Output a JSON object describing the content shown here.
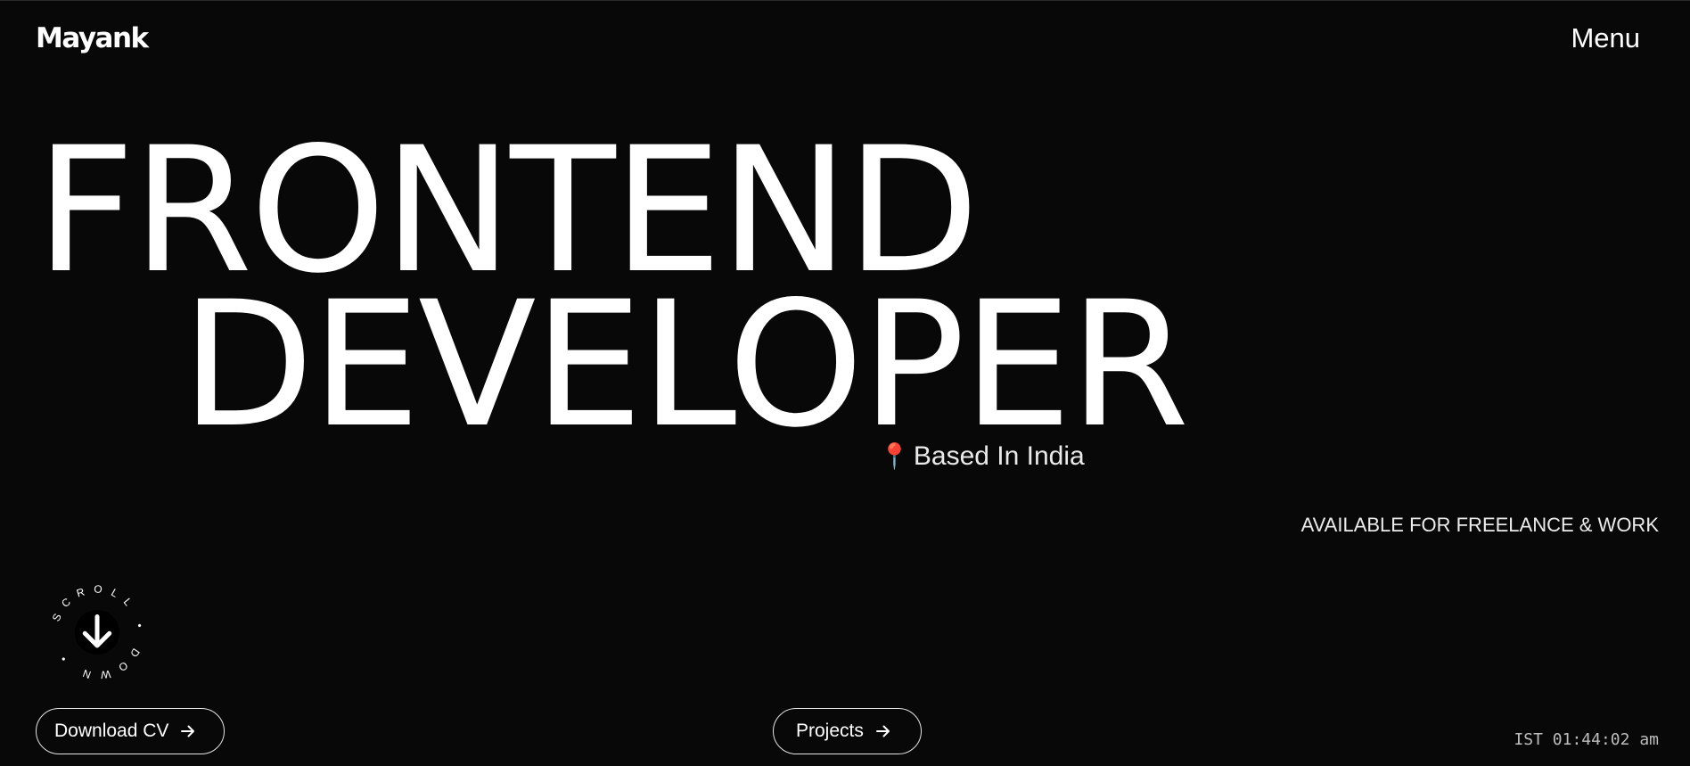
{
  "header": {
    "logo": "Mayank",
    "menu_label": "Menu"
  },
  "hero": {
    "line1": "FRONTEND",
    "line2": "DEVELOPER",
    "location_icon": "pushpin-icon",
    "location_text": "Based In India",
    "availability": "AVAILABLE FOR FREELANCE & WORK"
  },
  "scroll_badge": {
    "text": "SCROLL • DOWN •",
    "icon": "arrow-down-icon"
  },
  "actions": {
    "download_cv": "Download CV",
    "projects": "Projects",
    "arrow_icon": "arrow-right-icon"
  },
  "footer": {
    "clock": "IST 01:44:02 am"
  },
  "colors": {
    "background": "#080808",
    "text": "#ffffff",
    "pin": "#e8405a"
  }
}
